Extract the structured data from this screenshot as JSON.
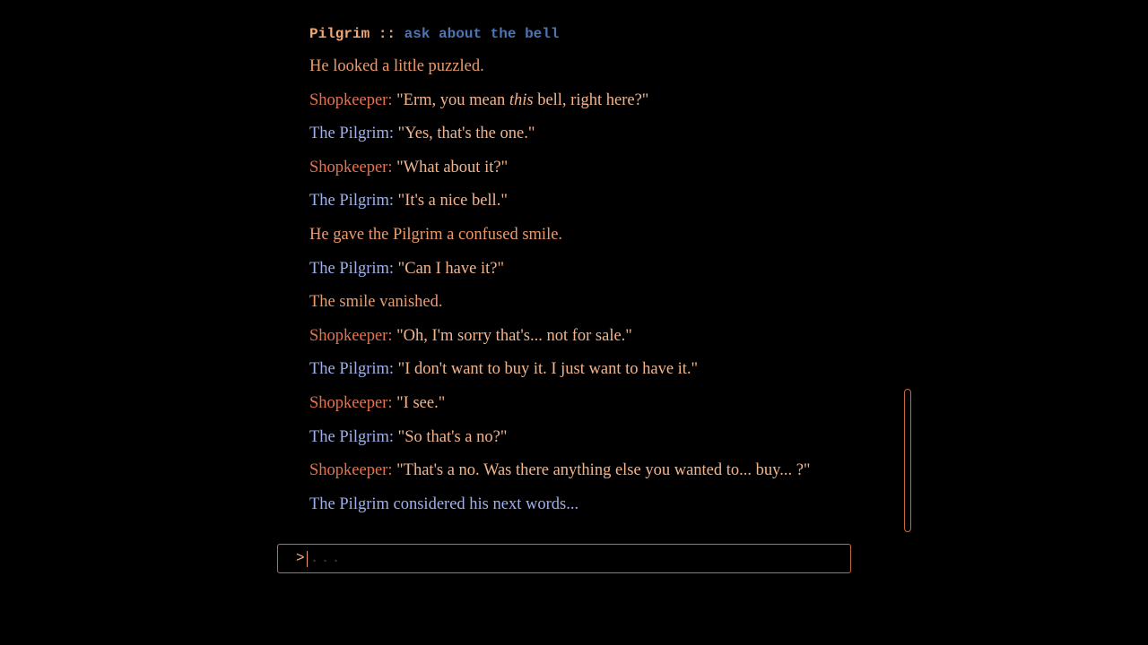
{
  "command_echo": {
    "speaker": "Pilgrim",
    "separator": "::",
    "command": "ask about the bell"
  },
  "log": [
    {
      "type": "narration",
      "text": "He looked a little puzzled."
    },
    {
      "type": "dialogue",
      "speaker": "Shopkeeper:",
      "pre": "\"Erm, you mean ",
      "em": "this",
      "post": " bell, right here?\""
    },
    {
      "type": "dialogue",
      "speaker": "The Pilgrim:",
      "text": "\"Yes, that's the one.\""
    },
    {
      "type": "dialogue",
      "speaker": "Shopkeeper:",
      "text": "\"What about it?\""
    },
    {
      "type": "dialogue",
      "speaker": "The Pilgrim:",
      "text": "\"It's a nice bell.\""
    },
    {
      "type": "narration",
      "text": "He gave the Pilgrim a confused smile."
    },
    {
      "type": "dialogue",
      "speaker": "The Pilgrim:",
      "text": "\"Can I have it?\""
    },
    {
      "type": "narration",
      "text": "The smile vanished."
    },
    {
      "type": "dialogue",
      "speaker": "Shopkeeper:",
      "text": "\"Oh, I'm sorry that's... not for sale.\""
    },
    {
      "type": "dialogue",
      "speaker": "The Pilgrim:",
      "text": "\"I don't want to buy it. I just want to have it.\""
    },
    {
      "type": "dialogue",
      "speaker": "Shopkeeper:",
      "text": "\"I see.\""
    },
    {
      "type": "dialogue",
      "speaker": "The Pilgrim:",
      "text": "\"So that's a no?\""
    },
    {
      "type": "dialogue",
      "speaker": "Shopkeeper:",
      "text": "\"That's a no. Was there anything else you wanted to... buy... ?\""
    },
    {
      "type": "narration_pilgrim",
      "text": "The Pilgrim considered his next words..."
    }
  ],
  "input": {
    "prompt": ">",
    "value": "",
    "placeholder": "..."
  },
  "colors": {
    "background": "#000000",
    "shopkeeper": "#e8714e",
    "pilgrim": "#9fb0ec",
    "speech": "#f2b48c",
    "command": "#4f74b4",
    "border": "#c8683e"
  }
}
